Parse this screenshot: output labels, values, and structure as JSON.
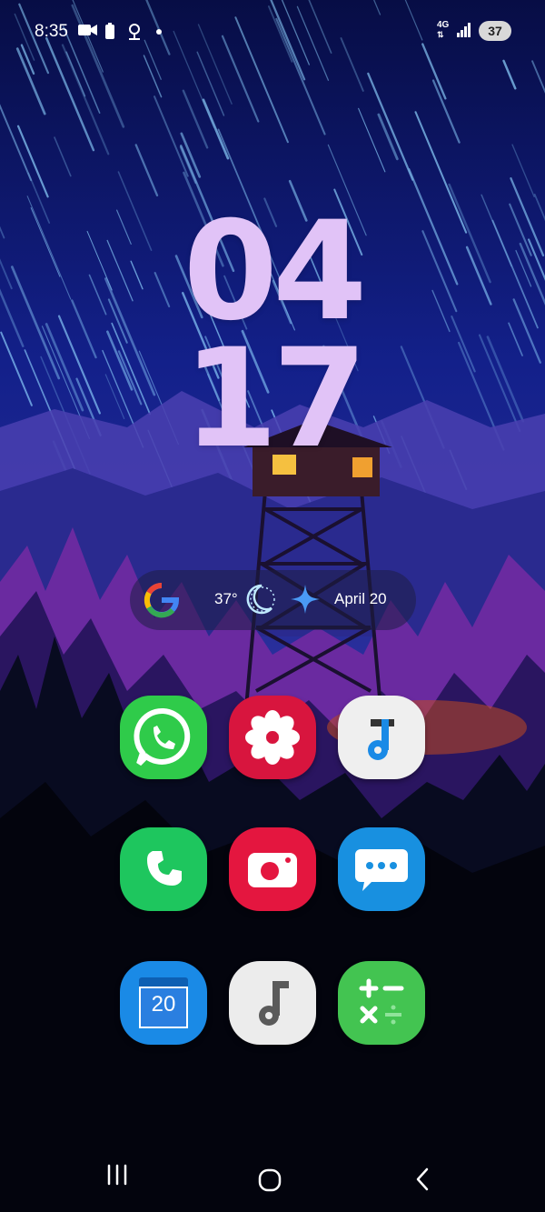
{
  "status_bar": {
    "time": "8:35",
    "icons": [
      "video-icon",
      "battery-saver-icon",
      "location-icon",
      "notification-dot-icon"
    ],
    "network": "4G",
    "battery": "37"
  },
  "clock": {
    "hour": "04",
    "minute": "17",
    "color": "#e1c3f7"
  },
  "at_a_glance": {
    "temperature": "37°",
    "weather_icon": "moon-icon",
    "assistant_icon": "gemini-sparkle-icon",
    "date": "April 20"
  },
  "apps": [
    {
      "row": 1,
      "name": "WhatsApp",
      "icon": "whatsapp-icon",
      "color": "#2fcb4a"
    },
    {
      "row": 1,
      "name": "Flower",
      "icon": "flower-icon",
      "color": "#d8153e"
    },
    {
      "row": 1,
      "name": "Music",
      "icon": "music-note-icon",
      "color": "#efefef"
    },
    {
      "row": 2,
      "name": "Phone",
      "icon": "phone-icon",
      "color": "#1ec65e"
    },
    {
      "row": 2,
      "name": "Screen Recorder",
      "icon": "screen-recorder-icon",
      "color": "#e4163f"
    },
    {
      "row": 2,
      "name": "Messages",
      "icon": "messages-icon",
      "color": "#1890e0"
    },
    {
      "row": 3,
      "name": "Calendar",
      "icon": "calendar-icon",
      "color": "#1a8ae6",
      "day": "20"
    },
    {
      "row": 3,
      "name": "Music Player",
      "icon": "music-note-icon",
      "color": "#ececec"
    },
    {
      "row": 3,
      "name": "Calculator",
      "icon": "calculator-icon",
      "color": "#43c451"
    }
  ],
  "nav_bar": {
    "buttons": [
      "recent-apps-icon",
      "home-icon",
      "back-icon"
    ]
  }
}
